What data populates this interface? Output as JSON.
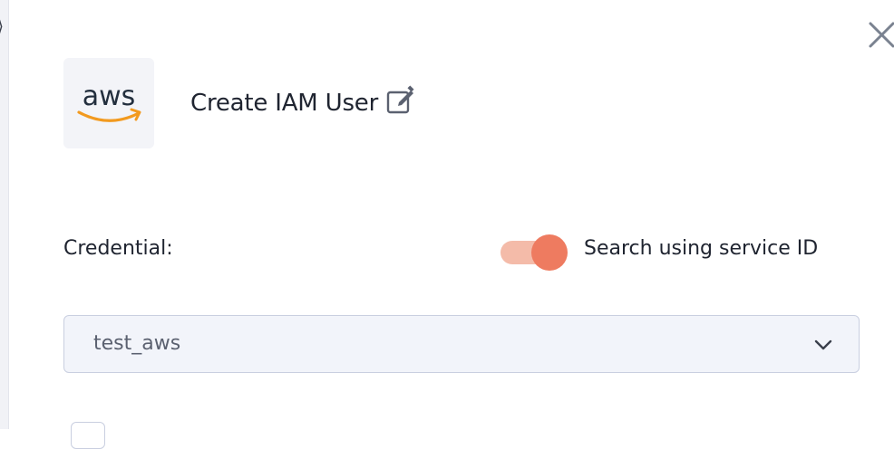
{
  "header": {
    "logo_text": "aws",
    "title": "Create IAM User",
    "edit_icon": "edit-icon",
    "close_icon": "close-icon"
  },
  "form": {
    "credential_label": "Credential:",
    "toggle": {
      "label": "Search using service ID",
      "on": true
    },
    "credential_select": {
      "value": "test_aws",
      "icon": "chevron-down-icon"
    }
  },
  "colors": {
    "toggle_knob": "#ee7b60",
    "toggle_track": "#f4bba9",
    "aws_smile": "#f29a1f",
    "aws_text": "#232f3e"
  }
}
